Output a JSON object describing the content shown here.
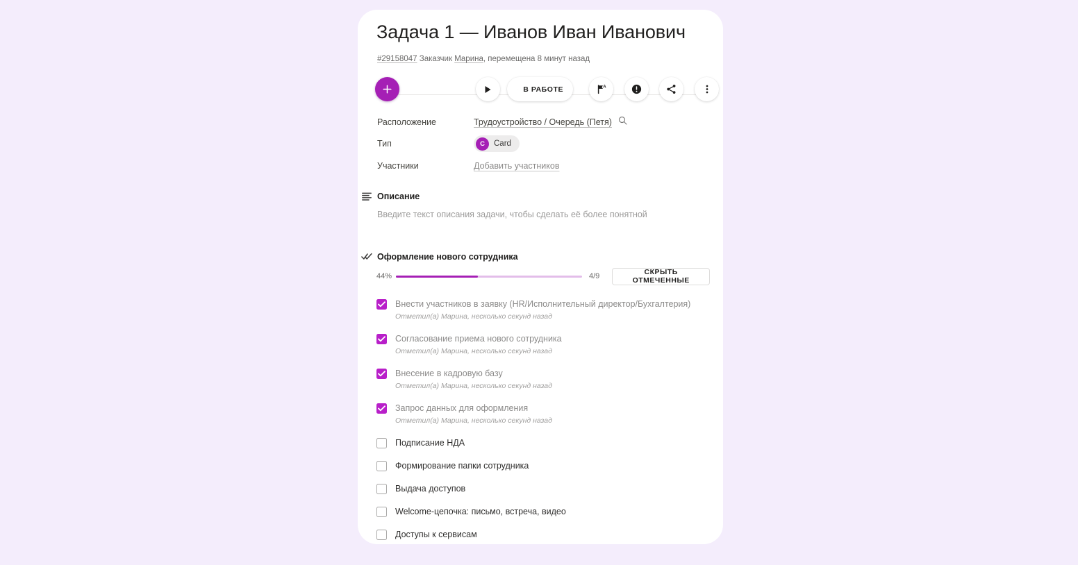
{
  "page": {
    "background_color": "#f4edfc",
    "card_background": "#ffffff",
    "accent_color": "#a51fb5"
  },
  "header": {
    "title": "Задача 1 — Иванов Иван Иванович",
    "task_id": "#29158047",
    "requester_label": "Заказчик",
    "requester_name": "Марина",
    "moved_text": ", перемещена 8 минут назад"
  },
  "toolbar": {
    "add_button_label": "+",
    "play_label": "play-icon",
    "status_label": "В РАБОТЕ",
    "flag_label": "flag-auto-icon",
    "priority_label": "priority-icon",
    "share_label": "share-icon",
    "more_label": "more-icon"
  },
  "properties": {
    "location": {
      "label": "Расположение",
      "value": "Трудоустройство / Очередь (Петя)"
    },
    "type": {
      "label": "Тип",
      "badge_initial": "C",
      "badge_text": "Card"
    },
    "members": {
      "label": "Участники",
      "add_link": "Добавить участников"
    }
  },
  "description": {
    "title": "Описание",
    "placeholder": "Введите текст описания задачи, чтобы сделать её более понятной"
  },
  "checklist": {
    "title": "Оформление нового сотрудника",
    "percent_label": "44%",
    "percent_value": 44,
    "fraction_label": "4/9",
    "completed": 4,
    "total": 9,
    "hide_checked_label": "СКРЫТЬ ОТМЕЧЕННЫЕ",
    "progress_fill_color": "#a51fb5",
    "progress_track_color": "#e3bde9",
    "items": [
      {
        "text": "Внести участников в заявку (HR/Исполнительный директор/Бухгалтерия)",
        "checked": true,
        "meta": "Отметил(а) Марина, несколько секунд назад"
      },
      {
        "text": "Согласование приема нового сотрудника",
        "checked": true,
        "meta": "Отметил(а) Марина, несколько секунд назад"
      },
      {
        "text": "Внесение в кадровую базу",
        "checked": true,
        "meta": "Отметил(а) Марина, несколько секунд назад"
      },
      {
        "text": "Запрос данных для оформления",
        "checked": true,
        "meta": "Отметил(а) Марина, несколько секунд назад"
      },
      {
        "text": "Подписание НДА",
        "checked": false,
        "meta": ""
      },
      {
        "text": "Формирование папки сотрудника",
        "checked": false,
        "meta": ""
      },
      {
        "text": "Выдача доступов",
        "checked": false,
        "meta": ""
      },
      {
        "text": "Welcome-цепочка: письмо, встреча, видео",
        "checked": false,
        "meta": ""
      },
      {
        "text": "Доступы к сервисам",
        "checked": false,
        "meta": ""
      }
    ]
  }
}
